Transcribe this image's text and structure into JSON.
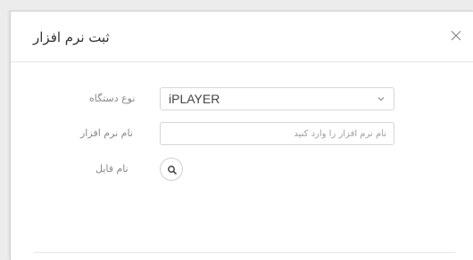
{
  "modal": {
    "title": "ثبت نرم افزار",
    "close_icon": "close-icon"
  },
  "form": {
    "device_type": {
      "label": "نوع دستگاه",
      "selected_value": "iPLAYER",
      "icon": "chevron-down-icon"
    },
    "software_name": {
      "label": "نام نرم افزار",
      "value": "",
      "placeholder": "نام نرم افزار را وارد کنید"
    },
    "file_name": {
      "label": "نام فایل",
      "icon": "search-icon"
    }
  }
}
